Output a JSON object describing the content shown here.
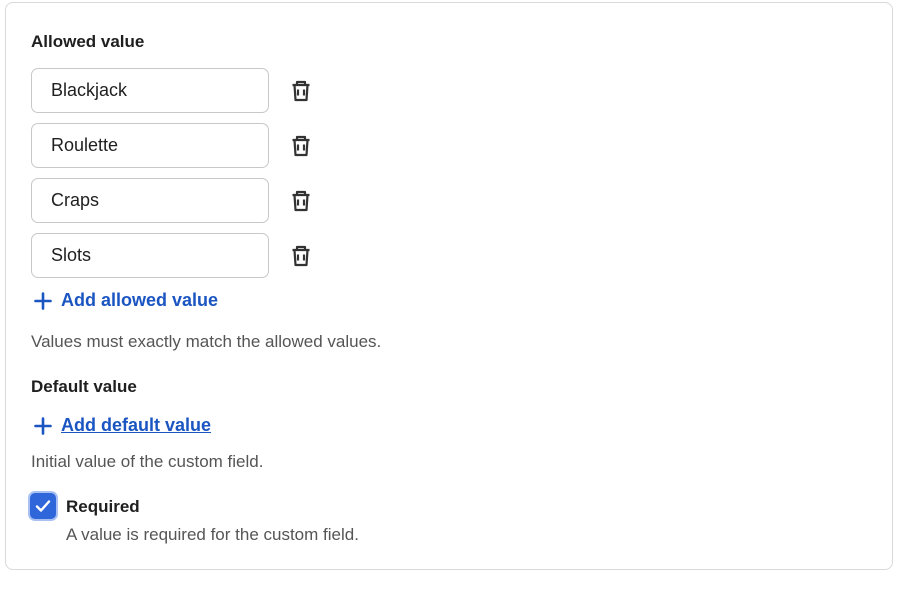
{
  "allowed_section": {
    "title": "Allowed value",
    "values": [
      "Blackjack",
      "Roulette",
      "Craps",
      "Slots"
    ],
    "add_label": "Add allowed value",
    "hint": "Values must exactly match the allowed values."
  },
  "default_section": {
    "title": "Default value",
    "add_label": "Add default value",
    "hint": "Initial value of the custom field."
  },
  "required": {
    "label": "Required",
    "checked": true,
    "description": "A value is required for the custom field."
  },
  "colors": {
    "accent": "#1a55c2",
    "checkbox": "#2f67db"
  }
}
